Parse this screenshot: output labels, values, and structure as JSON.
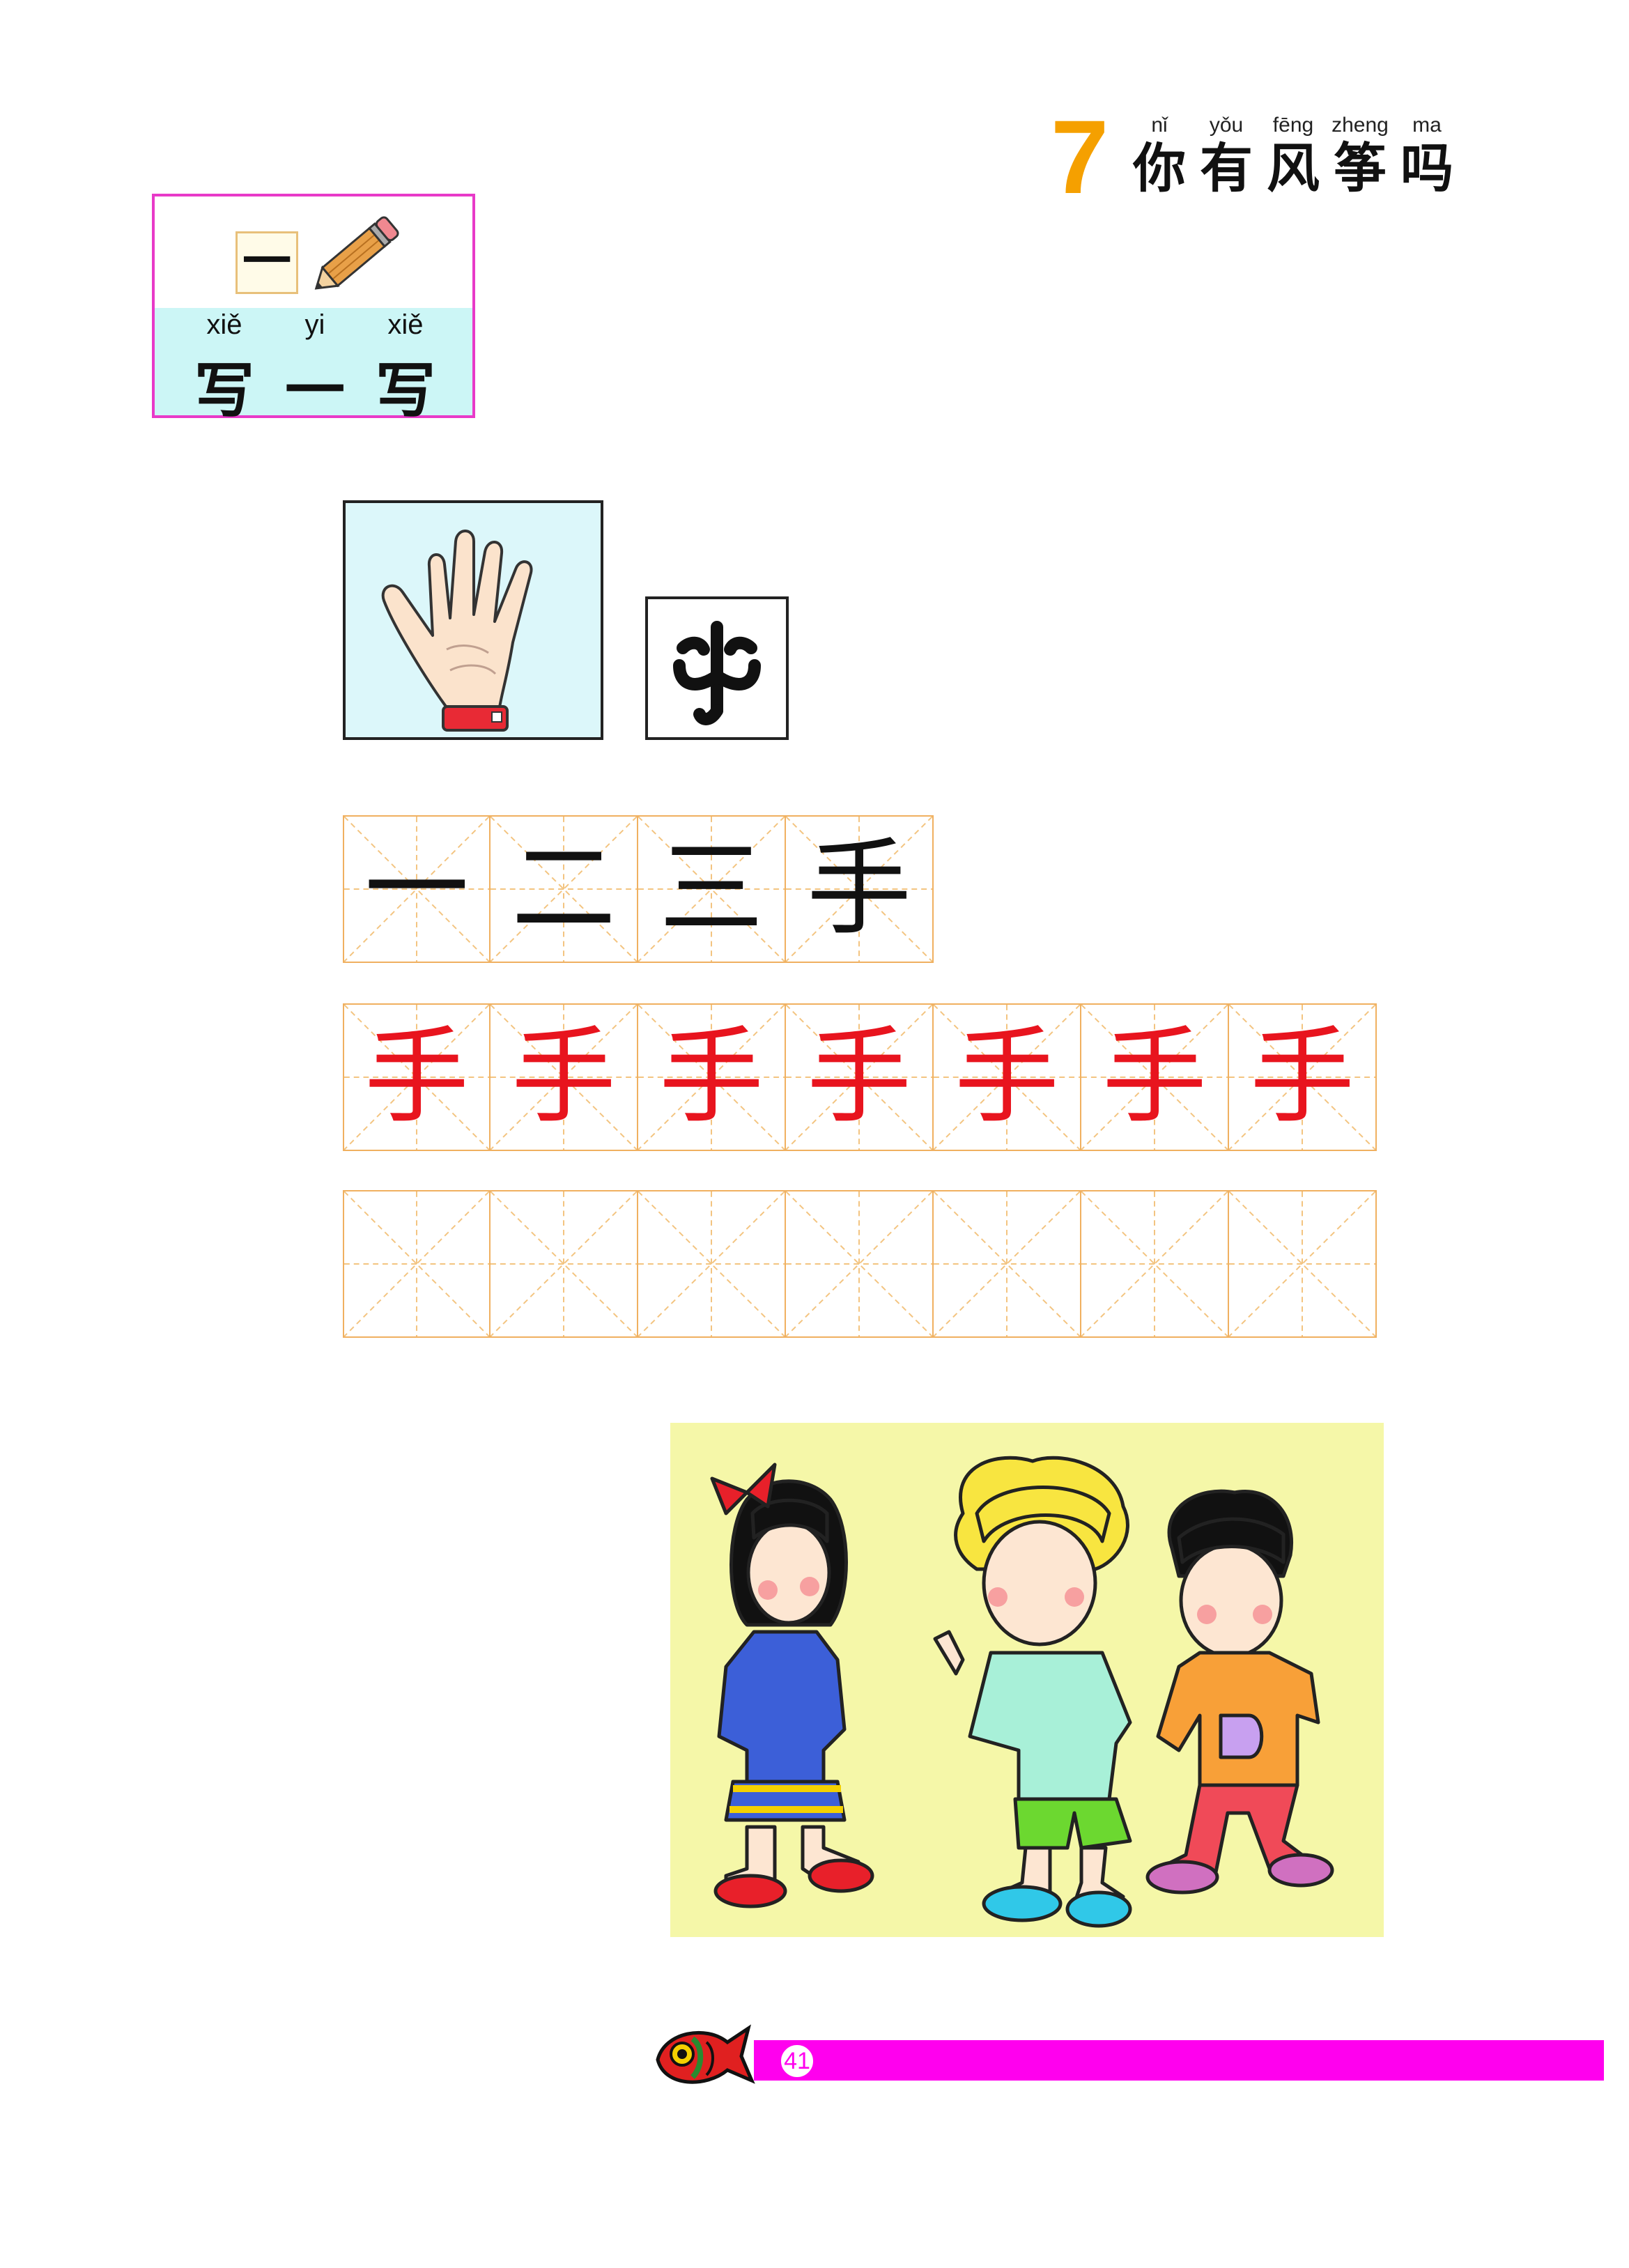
{
  "header": {
    "lesson_number": "7",
    "title_chars": [
      {
        "pinyin": "nǐ",
        "hanzi": "你"
      },
      {
        "pinyin": "yǒu",
        "hanzi": "有"
      },
      {
        "pinyin": "fēng",
        "hanzi": "风"
      },
      {
        "pinyin": "zheng",
        "hanzi": "筝"
      },
      {
        "pinyin": "ma",
        "hanzi": "吗"
      }
    ]
  },
  "badge": {
    "glyph": "一",
    "pinyin": [
      "xiě",
      "yi",
      "xiě"
    ],
    "hanzi": [
      "写",
      "一",
      "写"
    ],
    "pencil_icon": "pencil-icon"
  },
  "cards": {
    "hand_icon": "hand-icon",
    "oracle_icon": "oracle-bone-shou-icon"
  },
  "stroke_order": [
    "一",
    "二",
    "三",
    "手"
  ],
  "practice_red": [
    "手",
    "手",
    "手",
    "手",
    "手",
    "手",
    "手"
  ],
  "practice_empty_count": 7,
  "colors": {
    "lesson_number": "#f5a000",
    "badge_border": "#e83ac8",
    "grid_line": "#f0b060",
    "practice_red": "#e8141e",
    "footer": "#ff00ee"
  },
  "footer": {
    "page_number": "41",
    "fish_icon": "fish-icon"
  }
}
